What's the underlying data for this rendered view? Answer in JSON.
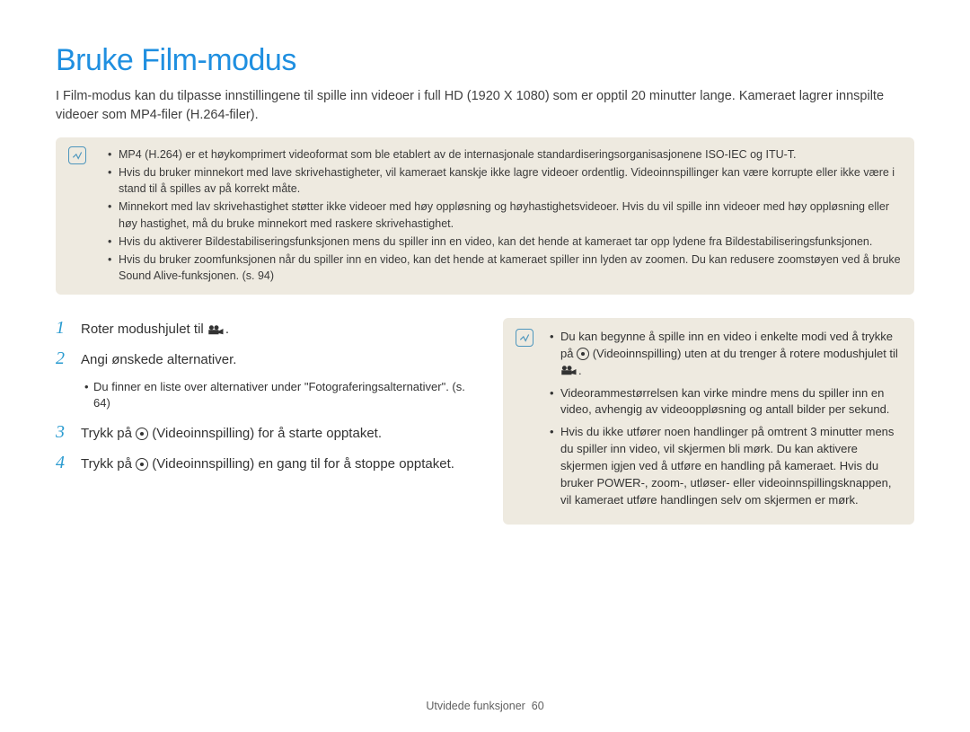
{
  "title": "Bruke Film-modus",
  "intro": "I Film-modus kan du tilpasse innstillingene til spille inn videoer i full HD (1920 X 1080) som er opptil 20 minutter lange. Kameraet lagrer innspilte videoer som MP4-filer (H.264-filer).",
  "top_notes": [
    "MP4 (H.264) er et høykomprimert videoformat som ble etablert av de internasjonale standardiseringsorganisasjonene ISO-IEC og ITU-T.",
    "Hvis du bruker minnekort med lave skrivehastigheter, vil kameraet kanskje ikke lagre videoer ordentlig. Videoinnspillinger kan være korrupte eller ikke være i stand til å spilles av på korrekt måte.",
    "Minnekort med lav skrivehastighet støtter ikke videoer med høy oppløsning og høyhastighetsvideoer. Hvis du vil spille inn videoer med høy oppløsning eller høy hastighet, må du bruke minnekort med raskere skrivehastighet.",
    "Hvis du aktiverer Bildestabiliseringsfunksjonen mens du spiller inn en video, kan det hende at kameraet tar opp lydene fra Bildestabiliseringsfunksjonen.",
    "Hvis du bruker zoomfunksjonen når du spiller inn en video, kan det hende at kameraet spiller inn lyden av zoomen. Du kan redusere zoomstøyen ved å bruke Sound Alive-funksjonen. (s. 94)"
  ],
  "steps": {
    "s1": {
      "num": "1",
      "text_a": "Roter modushjulet til ",
      "text_b": "."
    },
    "s2": {
      "num": "2",
      "text": "Angi ønskede alternativer.",
      "sub": "Du finner en liste over alternativer under \"Fotograferingsalternativer\". (s. 64)"
    },
    "s3": {
      "num": "3",
      "text_a": "Trykk på ",
      "text_b": " (Videoinnspilling) for å starte opptaket."
    },
    "s4": {
      "num": "4",
      "text_a": "Trykk på ",
      "text_b": " (Videoinnspilling) en gang til for å stoppe opptaket."
    }
  },
  "side_notes": {
    "n1_a": "Du kan begynne å spille inn en video i enkelte modi ved å trykke på ",
    "n1_b": " (Videoinnspilling) uten at du trenger å rotere modushjulet til ",
    "n1_c": ".",
    "n2": "Videorammestørrelsen kan virke mindre mens du spiller inn en video, avhengig av videooppløsning og antall bilder per sekund.",
    "n3": "Hvis du ikke utfører noen handlinger på omtrent 3 minutter mens du spiller inn video, vil skjermen bli mørk. Du kan aktivere skjermen igjen ved å utføre en handling på kameraet. Hvis du bruker POWER-, zoom-, utløser- eller videoinnspillingsknappen, vil kameraet utføre handlingen selv om skjermen er mørk."
  },
  "footer_label": "Utvidede funksjoner",
  "footer_page": "60"
}
